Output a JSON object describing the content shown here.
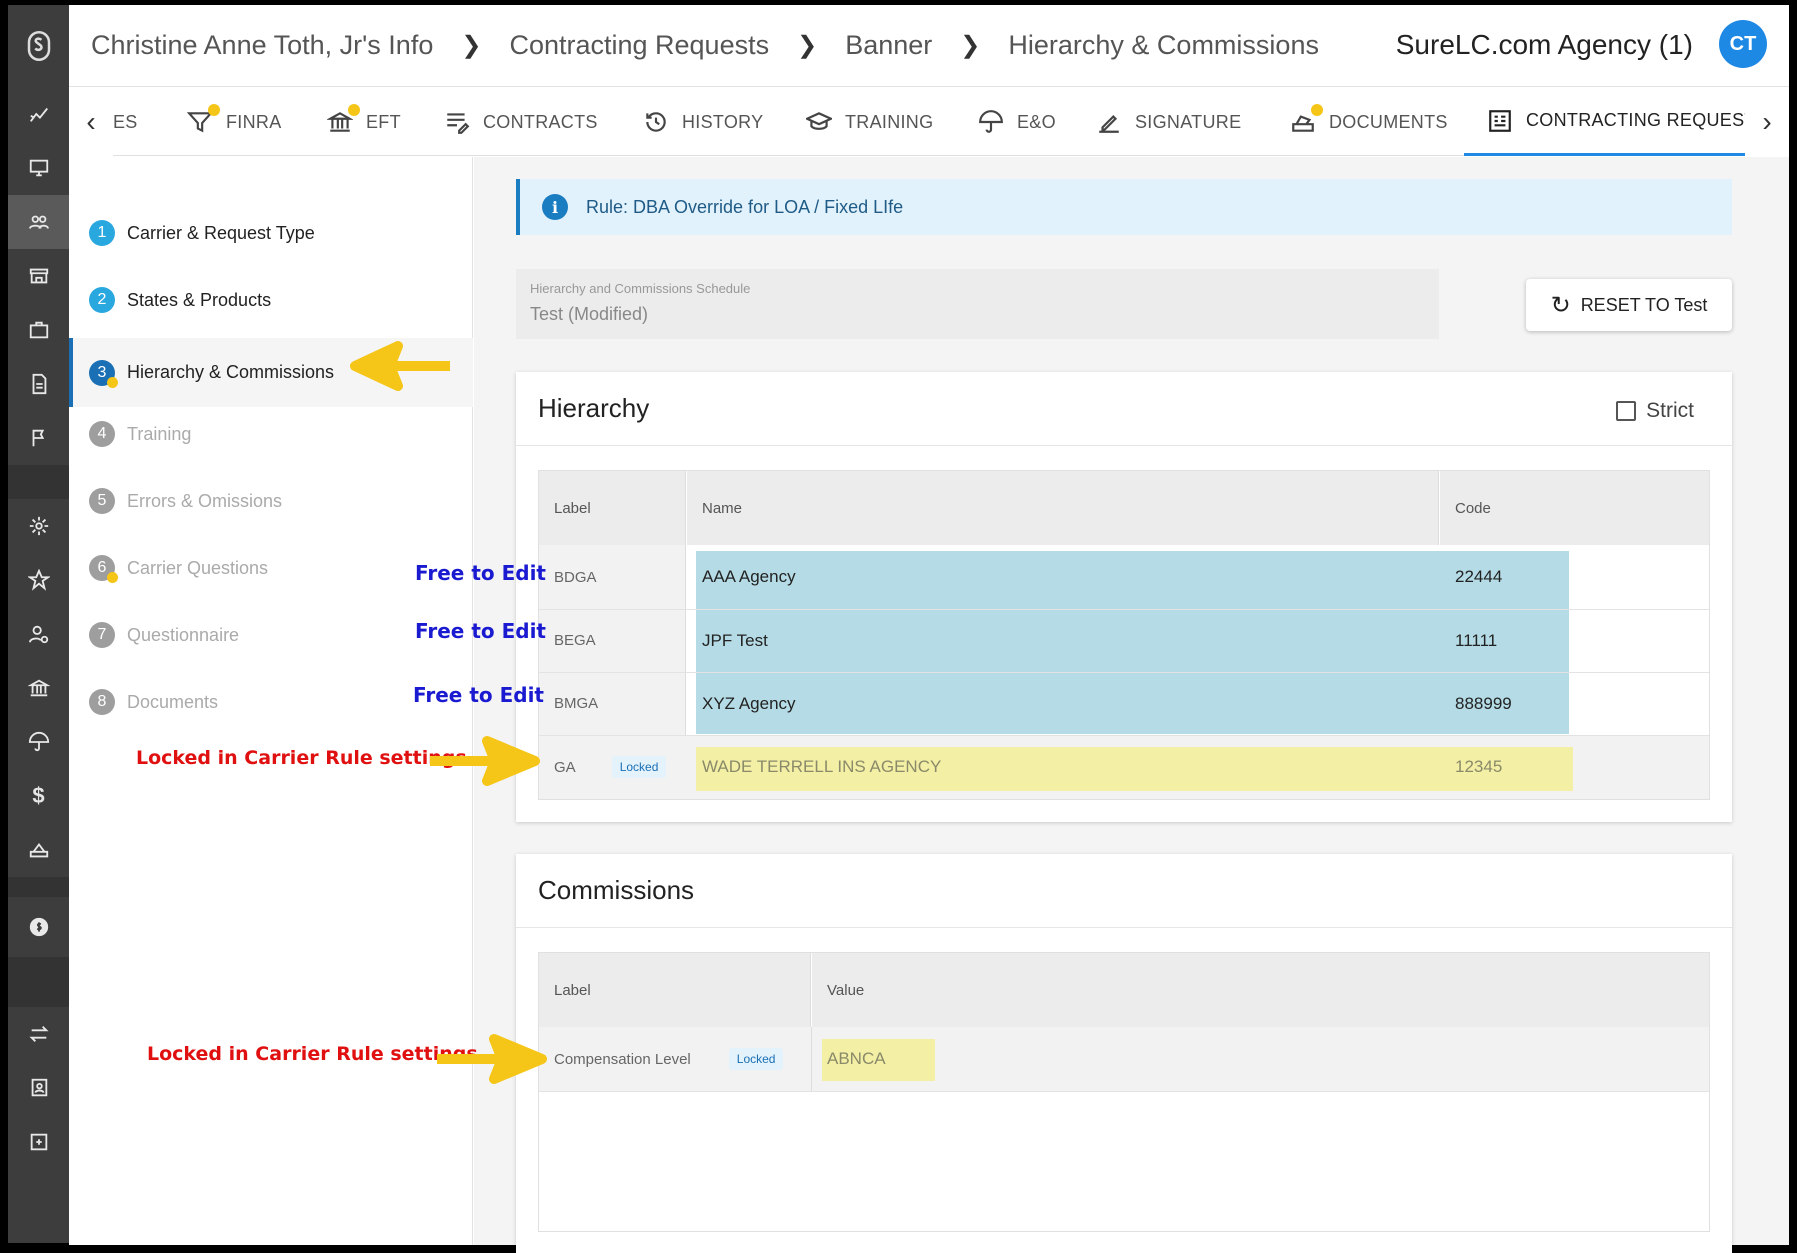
{
  "breadcrumbs": [
    "Christine Anne Toth, Jr's Info",
    "Contracting Requests",
    "Banner",
    "Hierarchy & Commissions"
  ],
  "agency": "SureLC.com Agency (1)",
  "avatar_initials": "CT",
  "tabs": {
    "partial_label": "ES",
    "items": [
      {
        "label": "FINRA",
        "icon": "finra-icon",
        "dot": true
      },
      {
        "label": "EFT",
        "icon": "bank-icon",
        "dot": true
      },
      {
        "label": "CONTRACTS",
        "icon": "contracts-icon",
        "dot": false
      },
      {
        "label": "HISTORY",
        "icon": "history-icon",
        "dot": false
      },
      {
        "label": "TRAINING",
        "icon": "training-icon",
        "dot": false
      },
      {
        "label": "E&O",
        "icon": "umbrella-icon",
        "dot": false
      },
      {
        "label": "SIGNATURE",
        "icon": "signature-icon",
        "dot": false
      },
      {
        "label": "DOCUMENTS",
        "icon": "documents-icon",
        "dot": true
      },
      {
        "label": "CONTRACTING REQUESTS",
        "icon": "contracting-requests-icon",
        "dot": false,
        "active": true
      }
    ]
  },
  "steps": [
    {
      "num": "1",
      "label": "Carrier & Request Type",
      "state": "done"
    },
    {
      "num": "2",
      "label": "States & Products",
      "state": "done"
    },
    {
      "num": "3",
      "label": "Hierarchy & Commissions",
      "state": "current"
    },
    {
      "num": "4",
      "label": "Training",
      "state": "todo"
    },
    {
      "num": "5",
      "label": "Errors & Omissions",
      "state": "todo"
    },
    {
      "num": "6",
      "label": "Carrier Questions",
      "state": "todo"
    },
    {
      "num": "7",
      "label": "Questionnaire",
      "state": "todo"
    },
    {
      "num": "8",
      "label": "Documents",
      "state": "todo"
    }
  ],
  "rule_text": "Rule: DBA Override for LOA / Fixed LIfe",
  "schedule": {
    "caption": "Hierarchy and Commissions Schedule",
    "value": "Test  (Modified)"
  },
  "reset_label": "RESET TO Test",
  "hierarchy": {
    "title": "Hierarchy",
    "strict_label": "Strict",
    "columns": [
      "Label",
      "Name",
      "Code"
    ],
    "rows": [
      {
        "label": "BDGA",
        "name": "AAA Agency",
        "code": "22444"
      },
      {
        "label": "BEGA",
        "name": "JPF Test",
        "code": "11111"
      },
      {
        "label": "BMGA",
        "name": "XYZ Agency",
        "code": "888999"
      },
      {
        "label": "GA",
        "name": "WADE TERRELL INS AGENCY",
        "code": "12345",
        "locked": "Locked"
      }
    ]
  },
  "commissions": {
    "title": "Commissions",
    "columns": [
      "Label",
      "Value"
    ],
    "rows": [
      {
        "label": "Compensation Level",
        "value": "ABNCA",
        "locked": "Locked"
      }
    ]
  },
  "annotations": {
    "free_to_edit": "Free to Edit",
    "locked_note": "Locked in Carrier Rule settings"
  },
  "colors": {
    "accent": "#1e88e5",
    "editable_highlight": "#b5dce6",
    "locked_highlight": "#f3efa5",
    "annotation_arrow": "#f5c518"
  }
}
